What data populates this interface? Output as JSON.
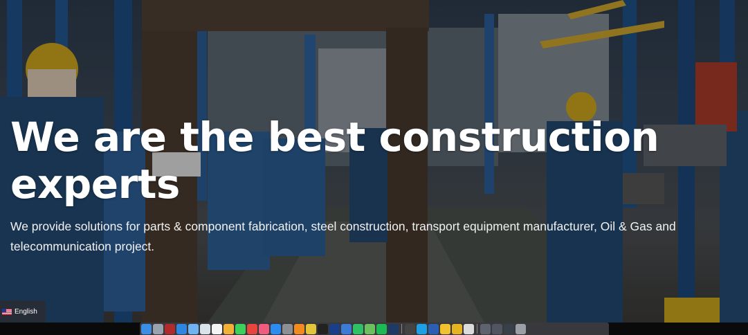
{
  "hero": {
    "headline": "We are the best construction experts",
    "subtext": "We provide solutions for parts & component fabrication, steel construction, transport equipment manufacturer, Oil & Gas and telecommunication project."
  },
  "language": {
    "label": "English",
    "flag_icon": "us-flag-icon"
  },
  "colors": {
    "headline_text": "#ffffff",
    "hero_overlay": "#000000",
    "dock_background": "#3c3c40"
  },
  "dock": {
    "icons": [
      {
        "name": "finder-icon",
        "color": "#3a8ee6"
      },
      {
        "name": "launchpad-icon",
        "color": "#9aa3ad"
      },
      {
        "name": "photo-booth-icon",
        "color": "#b22b2b"
      },
      {
        "name": "safari-icon",
        "color": "#2f86e0"
      },
      {
        "name": "mail-icon",
        "color": "#6fb3f2"
      },
      {
        "name": "preview-icon",
        "color": "#dbe3ea"
      },
      {
        "name": "calendar-icon",
        "color": "#f4f4f4"
      },
      {
        "name": "photos-icon",
        "color": "#f2b134"
      },
      {
        "name": "messages-icon",
        "color": "#3bd15a"
      },
      {
        "name": "news-icon",
        "color": "#e8453c"
      },
      {
        "name": "music-icon",
        "color": "#f05c7e"
      },
      {
        "name": "app-store-icon",
        "color": "#2d8cf0"
      },
      {
        "name": "system-preferences-icon",
        "color": "#8b8f94"
      },
      {
        "name": "firefox-icon",
        "color": "#f28a1e"
      },
      {
        "name": "chrome-icon",
        "color": "#e3c53a"
      },
      {
        "name": "terminal-icon",
        "color": "#222222"
      },
      {
        "name": "sourcetree-icon",
        "color": "#1a3f8a"
      },
      {
        "name": "xcode-icon",
        "color": "#3c7bd6"
      },
      {
        "name": "whatsapp-icon",
        "color": "#2ec264"
      },
      {
        "name": "maps-icon",
        "color": "#6cc05e"
      },
      {
        "name": "spotify-icon",
        "color": "#1db954"
      },
      {
        "name": "photoshop-icon",
        "color": "#1e3b66"
      },
      {
        "name": "activity-monitor-icon",
        "color": "#444444"
      },
      {
        "name": "skype-icon",
        "color": "#1ea0e6"
      },
      {
        "name": "word-icon",
        "color": "#2b5fb4"
      },
      {
        "name": "cyberduck-icon",
        "color": "#f2c12e"
      },
      {
        "name": "sequel-pro-icon",
        "color": "#e6b422"
      },
      {
        "name": "documents-icon",
        "color": "#dcdcdc"
      },
      {
        "name": "screenshots-folder-icon",
        "color": "#5d6470"
      },
      {
        "name": "downloads-folder-icon",
        "color": "#4f5661"
      },
      {
        "name": "window-preview-icon",
        "color": "#38404a"
      },
      {
        "name": "trash-icon",
        "color": "#9aa0a6"
      }
    ]
  }
}
